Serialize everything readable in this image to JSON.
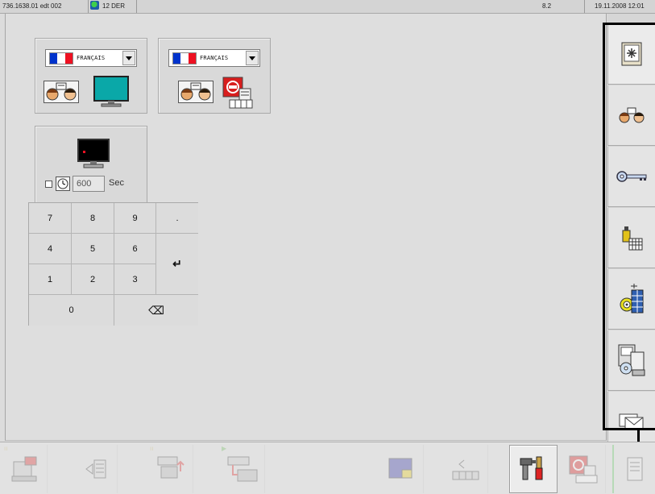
{
  "status_bar": {
    "system_id": "736.1638.01 edt 002",
    "mode": "12 DER",
    "version": "8.2",
    "date": "19.11.2008 12:01"
  },
  "language_panel_1": {
    "language": "FRANÇAIS",
    "icons": [
      "dialog-icon",
      "monitor-icon"
    ]
  },
  "language_panel_2": {
    "language": "FRANÇAIS",
    "icons": [
      "dialog-icon",
      "printer-report-icon"
    ]
  },
  "screensaver_panel": {
    "timeout_value": "600",
    "unit_label": "Sec",
    "enabled": false
  },
  "keypad": {
    "keys": [
      "7",
      "8",
      "9",
      ".",
      "4",
      "5",
      "6",
      "1",
      "2",
      "3",
      "0"
    ],
    "enter_symbol": "↵",
    "backspace_symbol": "⌫"
  },
  "right_toolbar": {
    "items": [
      {
        "name": "display-settings-icon",
        "active": true
      },
      {
        "name": "language-dialog-icon",
        "active": false
      },
      {
        "name": "password-key-icon",
        "active": false
      },
      {
        "name": "oil-calendar-icon",
        "active": false
      },
      {
        "name": "reel-schedule-icon",
        "active": false
      },
      {
        "name": "backup-media-icon",
        "active": false
      },
      {
        "name": "mail-envelope-icon",
        "active": false
      }
    ]
  },
  "bottom_toolbar": {
    "items": [
      {
        "name": "display-transfer-icon",
        "enabled": false
      },
      {
        "name": "sound-list-icon",
        "enabled": false
      },
      {
        "name": "keyboard-upload-icon",
        "enabled": false
      },
      {
        "name": "network-transfer-icon",
        "enabled": false
      },
      {
        "name": "blank-slot",
        "enabled": false
      },
      {
        "name": "image-edit-icon",
        "enabled": false
      },
      {
        "name": "audio-keyboard-icon",
        "enabled": false
      },
      {
        "name": "tools-icon",
        "enabled": true
      },
      {
        "name": "stop-printer-icon",
        "enabled": false
      },
      {
        "name": "document-icon",
        "enabled": false
      }
    ]
  },
  "colors": {
    "flag_blue": "#0033cc",
    "flag_white": "#ffffff",
    "flag_red": "#ee1122",
    "screen_teal": "#0aa8a8",
    "stop_red": "#d81e1e"
  }
}
